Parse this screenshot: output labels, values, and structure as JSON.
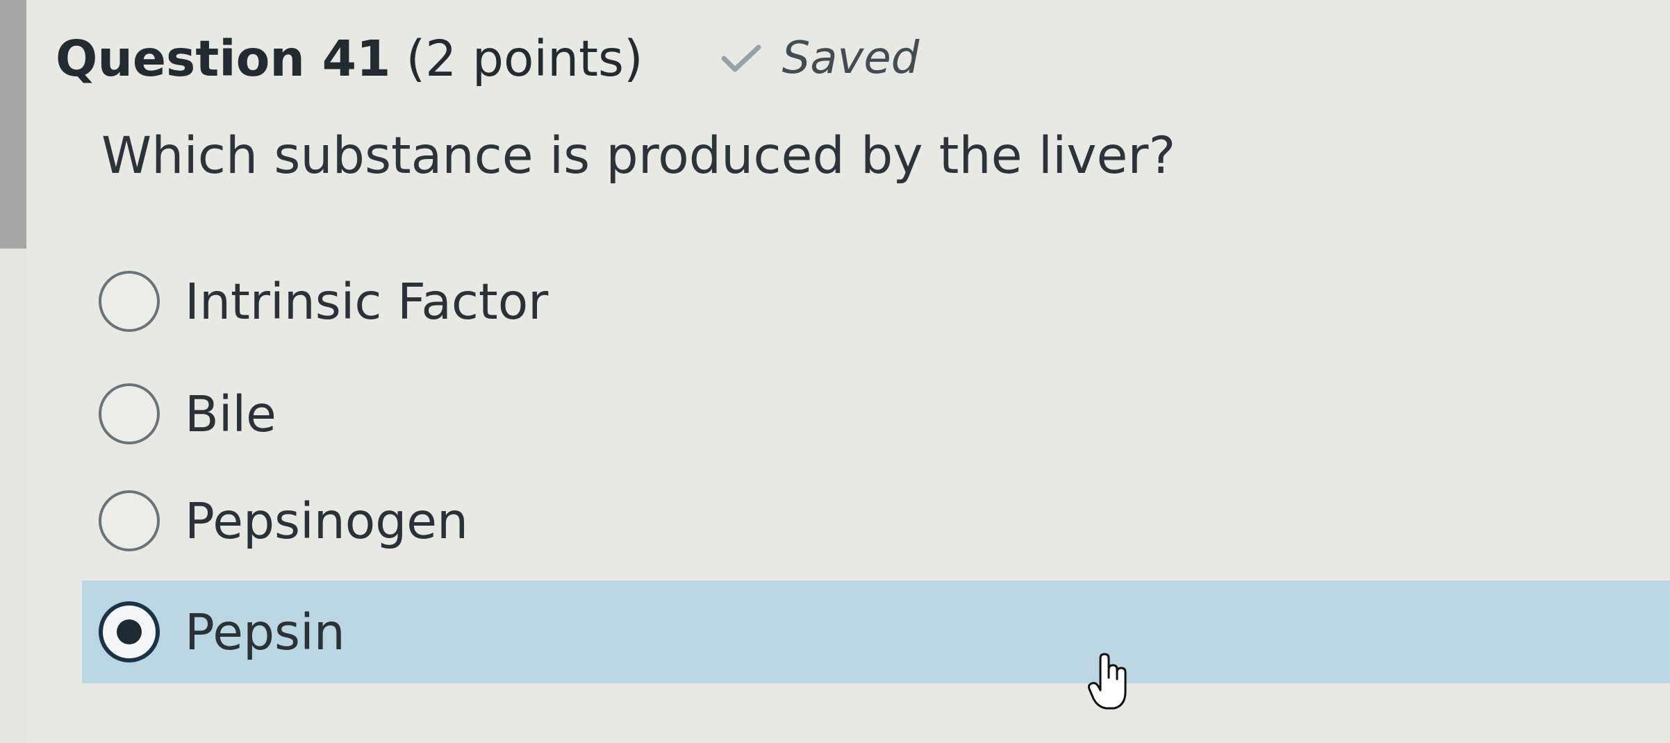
{
  "question": {
    "title": "Question 41",
    "points": "(2 points)",
    "saved_status": "Saved",
    "saved_icon": "checkmark-icon",
    "prompt": "Which substance is produced by the liver?"
  },
  "options": [
    {
      "label": "Intrinsic Factor",
      "selected": false
    },
    {
      "label": "Bile",
      "selected": false
    },
    {
      "label": "Pepsinogen",
      "selected": false
    },
    {
      "label": "Pepsin",
      "selected": true
    }
  ],
  "colors": {
    "selected_highlight": "#b9d6e2",
    "background": "#e8e8e5",
    "text": "#2d3338"
  },
  "cursor_icon": "hand-pointer-icon"
}
